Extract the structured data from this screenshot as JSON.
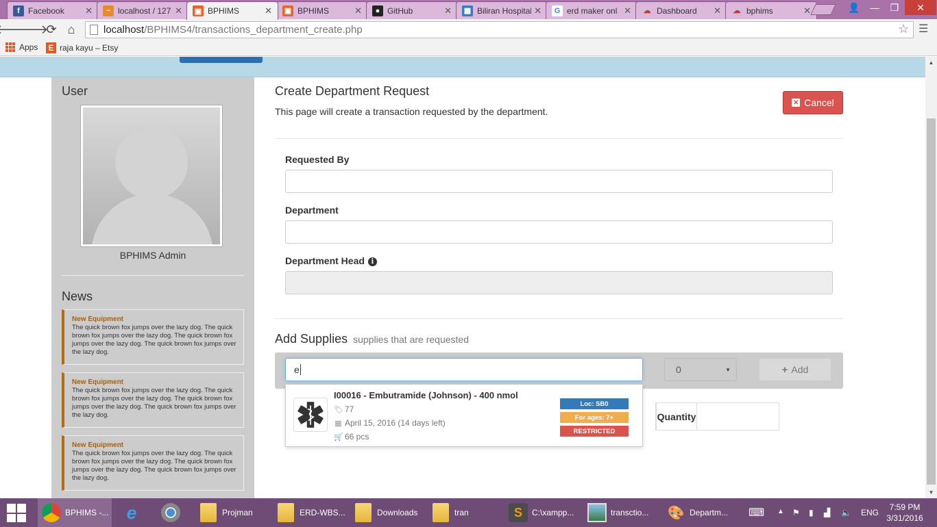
{
  "browser": {
    "tabs": [
      {
        "label": "Facebook",
        "color": "#3b5998",
        "glyph": "f"
      },
      {
        "label": "localhost / 127",
        "color": "#e98b2b",
        "glyph": "~"
      },
      {
        "label": "BPHIMS",
        "color": "#e8642c",
        "glyph": "▣",
        "active": true
      },
      {
        "label": "BPHIMS",
        "color": "#e8642c",
        "glyph": "▣"
      },
      {
        "label": "GitHub",
        "color": "#222222",
        "glyph": "●"
      },
      {
        "label": "Biliran Hospital",
        "color": "#3a7cbf",
        "glyph": "▦"
      },
      {
        "label": "erd maker onl",
        "color": "#ffffff",
        "glyph": "G"
      },
      {
        "label": "Dashboard",
        "color": "#c0392b",
        "glyph": "☁"
      },
      {
        "label": "bphims",
        "color": "#c0392b",
        "glyph": "☁"
      }
    ],
    "url_host": "localhost",
    "url_path": "/BPHIMS4/transactions_department_create.php",
    "bookmarks": {
      "apps": "Apps",
      "etsy": "raja kayu – Etsy"
    }
  },
  "sidebar": {
    "user_heading": "User",
    "admin_name": "BPHIMS Admin",
    "news_heading": "News",
    "news": [
      {
        "title": "New Equipment",
        "body": "The quick brown fox jumps over the lazy dog. The quick brown fox jumps over the lazy dog. The quick brown fox jumps over the lazy dog. The quick brown fox jumps over the lazy dog."
      },
      {
        "title": "New Equipment",
        "body": "The quick brown fox jumps over the lazy dog. The quick brown fox jumps over the lazy dog. The quick brown fox jumps over the lazy dog. The quick brown fox jumps over the lazy dog."
      },
      {
        "title": "New Equipment",
        "body": "The quick brown fox jumps over the lazy dog. The quick brown fox jumps over the lazy dog. The quick brown fox jumps over the lazy dog. The quick brown fox jumps over the lazy dog."
      }
    ]
  },
  "main": {
    "title": "Create Department Request",
    "subtitle": "This page will create a transaction requested by the department.",
    "cancel_label": "Cancel",
    "fields": {
      "requested_by": "Requested By",
      "department": "Department",
      "department_head": "Department Head"
    },
    "supplies": {
      "title": "Add Supplies",
      "subtitle": "supplies that are requested",
      "search_value": "e",
      "quantity_value": "0",
      "add_label": "Add",
      "table_quantity_header": "Quantity"
    },
    "autocomplete": {
      "name": "I00016 - Embutramide (Johnson) - 400 nmol",
      "tag": "77",
      "expiry": "April 15, 2016 (14 days left)",
      "stock": "66 pcs",
      "badges": [
        {
          "label": "Loc: SB0",
          "color": "#337ab7"
        },
        {
          "label": "For ages: 7+",
          "color": "#f0ad4e"
        },
        {
          "label": "RESTRICTED",
          "color": "#d9534f"
        }
      ]
    }
  },
  "taskbar": {
    "items": [
      {
        "label": "BPHIMS -..."
      },
      {
        "label": "Projman"
      },
      {
        "label": "ERD-WBS..."
      },
      {
        "label": "Downloads"
      },
      {
        "label": "tran"
      },
      {
        "label": "C:\\xampp..."
      },
      {
        "label": "transctio..."
      },
      {
        "label": "Departm..."
      }
    ],
    "lang": "ENG",
    "time": "7:59 PM",
    "date": "3/31/2016"
  }
}
